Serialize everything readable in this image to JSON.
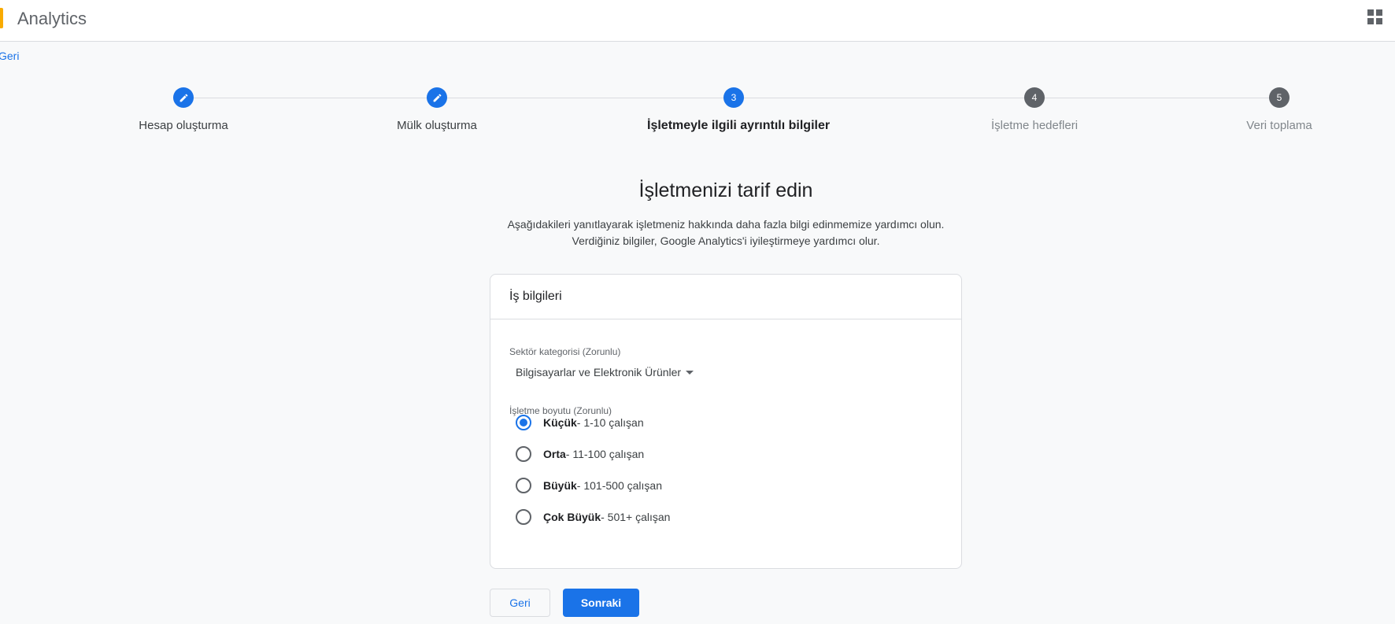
{
  "app": {
    "title": "Analytics"
  },
  "nav": {
    "back_link": "Geri"
  },
  "steps": [
    {
      "label": "Hesap oluşturma",
      "number": "",
      "state": "done"
    },
    {
      "label": "Mülk oluşturma",
      "number": "",
      "state": "done"
    },
    {
      "label": "İşletmeyle ilgili ayrıntılı bilgiler",
      "number": "3",
      "state": "active"
    },
    {
      "label": "İşletme hedefleri",
      "number": "4",
      "state": "todo"
    },
    {
      "label": "Veri toplama",
      "number": "5",
      "state": "todo"
    }
  ],
  "page": {
    "title": "İşletmenizi tarif edin",
    "subtitle_line1": "Aşağıdakileri yanıtlayarak işletmeniz hakkında daha fazla bilgi edinmemize yardımcı olun.",
    "subtitle_line2": "Verdiğiniz bilgiler, Google Analytics'i iyileştirmeye yardımcı olur."
  },
  "card": {
    "header": "İş bilgileri",
    "sector_label": "Sektör kategorisi (Zorunlu)",
    "sector_value": "Bilgisayarlar ve Elektronik Ürünler",
    "size_label": "İşletme boyutu (Zorunlu)",
    "size_options": [
      {
        "name": "Küçük",
        "detail": " - 1-10 çalışan",
        "checked": true
      },
      {
        "name": "Orta",
        "detail": " - 11-100 çalışan",
        "checked": false
      },
      {
        "name": "Büyük",
        "detail": " - 101-500 çalışan",
        "checked": false
      },
      {
        "name": "Çok Büyük",
        "detail": " - 501+ çalışan",
        "checked": false
      }
    ]
  },
  "buttons": {
    "back": "Geri",
    "next": "Sonraki"
  },
  "colors": {
    "primary": "#1a73e8",
    "logo": "#f9ab00",
    "inactive_step": "#5f6368"
  },
  "icons": {
    "done_step": "pencil-icon",
    "apps": "apps-grid-icon",
    "dropdown": "caret-down-icon"
  }
}
